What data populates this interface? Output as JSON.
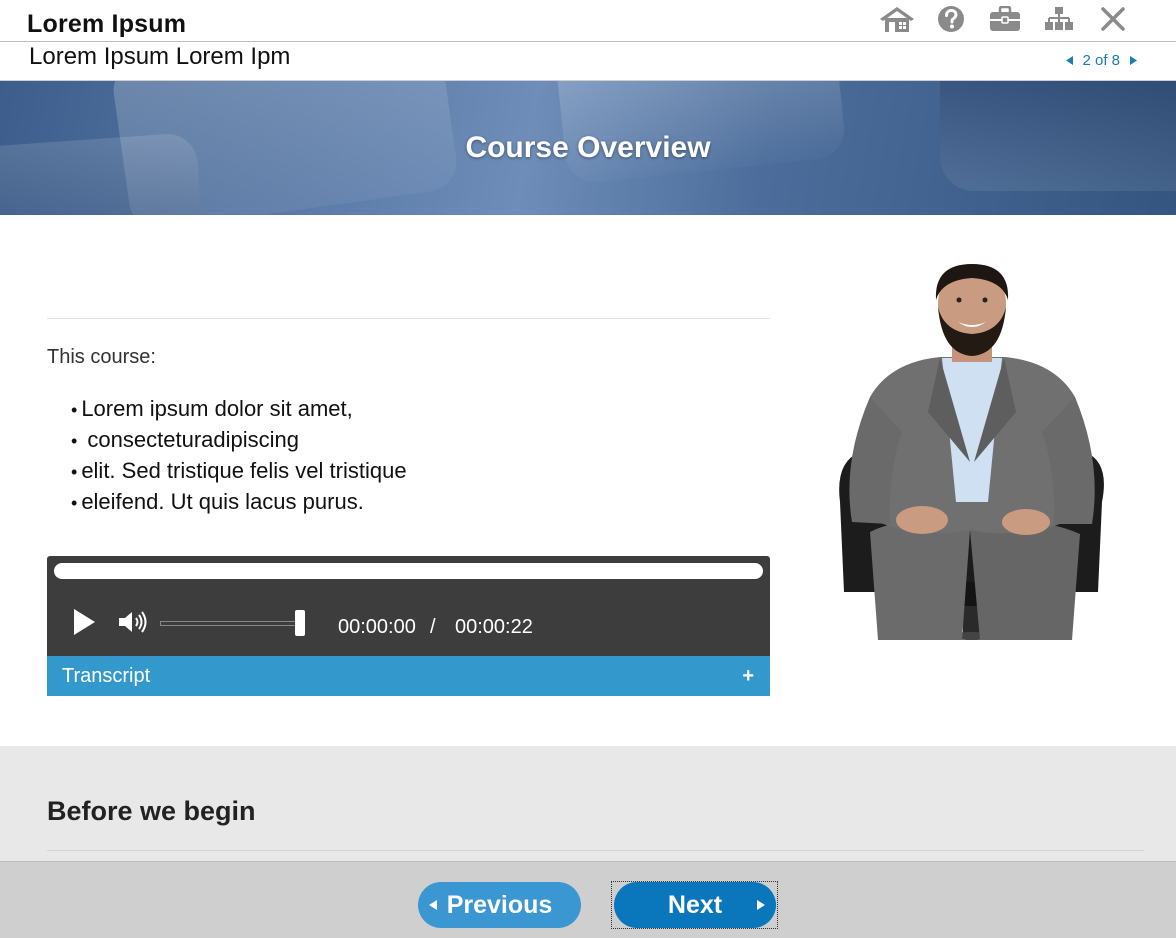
{
  "header": {
    "app_title": "Lorem Ipsum",
    "course_title": "Lorem Ipsum Lorem Ipm",
    "toolbar_icons": [
      "home-icon",
      "help-icon",
      "toolbox-icon",
      "sitemap-icon",
      "close-icon"
    ],
    "pager": {
      "text": "2 of 8"
    }
  },
  "banner": {
    "title": "Course Overview"
  },
  "content": {
    "intro": "This course:",
    "bullets": [
      "Lorem ipsum dolor sit amet,",
      " consecteturadipiscing",
      "elit. Sed tristique felis vel tristique",
      "eleifend. Ut quis lacus purus."
    ]
  },
  "player": {
    "current_time": "00:00:00",
    "separator": "/",
    "duration": "00:00:22",
    "progress": 0,
    "volume": 1.0
  },
  "transcript": {
    "label": "Transcript",
    "toggle": "+"
  },
  "section2": {
    "title": "Before we begin"
  },
  "footer": {
    "previous_label": "Previous",
    "next_label": "Next"
  },
  "colors": {
    "accent": "#3399cc",
    "next_button": "#0a77bd",
    "previous_button": "#3a97d1",
    "player_bg": "#3d3d3d",
    "pager_text": "#1a7db6"
  }
}
